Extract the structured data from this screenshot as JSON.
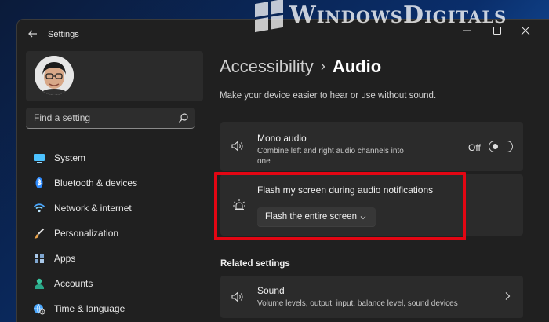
{
  "watermark": {
    "text": "WindowsDigitals"
  },
  "window": {
    "title": "Settings",
    "controls": [
      "minimize",
      "maximize",
      "close"
    ]
  },
  "sidebar": {
    "search": {
      "placeholder": "Find a setting"
    },
    "items": [
      {
        "label": "System",
        "icon": "monitor-icon",
        "color": "#4cc2ff"
      },
      {
        "label": "Bluetooth & devices",
        "icon": "bluetooth-icon",
        "color": "#3b9bff"
      },
      {
        "label": "Network & internet",
        "icon": "wifi-icon",
        "color": "#7fd3ff"
      },
      {
        "label": "Personalization",
        "icon": "brush-icon",
        "color": "#e8a24a"
      },
      {
        "label": "Apps",
        "icon": "apps-icon",
        "color": "#a9c8e8"
      },
      {
        "label": "Accounts",
        "icon": "person-icon",
        "color": "#39c6a0"
      },
      {
        "label": "Time & language",
        "icon": "globe-clock-icon",
        "color": "#4aa8ff"
      }
    ]
  },
  "main": {
    "breadcrumb": {
      "parent": "Accessibility",
      "separator": "›",
      "current": "Audio"
    },
    "subtitle": "Make your device easier to hear or use without sound.",
    "mono_audio": {
      "title": "Mono audio",
      "description": "Combine left and right audio channels into one",
      "toggle_state": "Off"
    },
    "flash": {
      "title": "Flash my screen during audio notifications",
      "selected_option": "Flash the entire screen"
    },
    "related": {
      "heading": "Related settings",
      "sound": {
        "title": "Sound",
        "description": "Volume levels, output, input, balance level, sound devices"
      }
    }
  },
  "colors": {
    "window_bg": "#202020",
    "card_bg": "#2b2b2b",
    "highlight": "#e30613",
    "accent": "#4cc2ff"
  }
}
